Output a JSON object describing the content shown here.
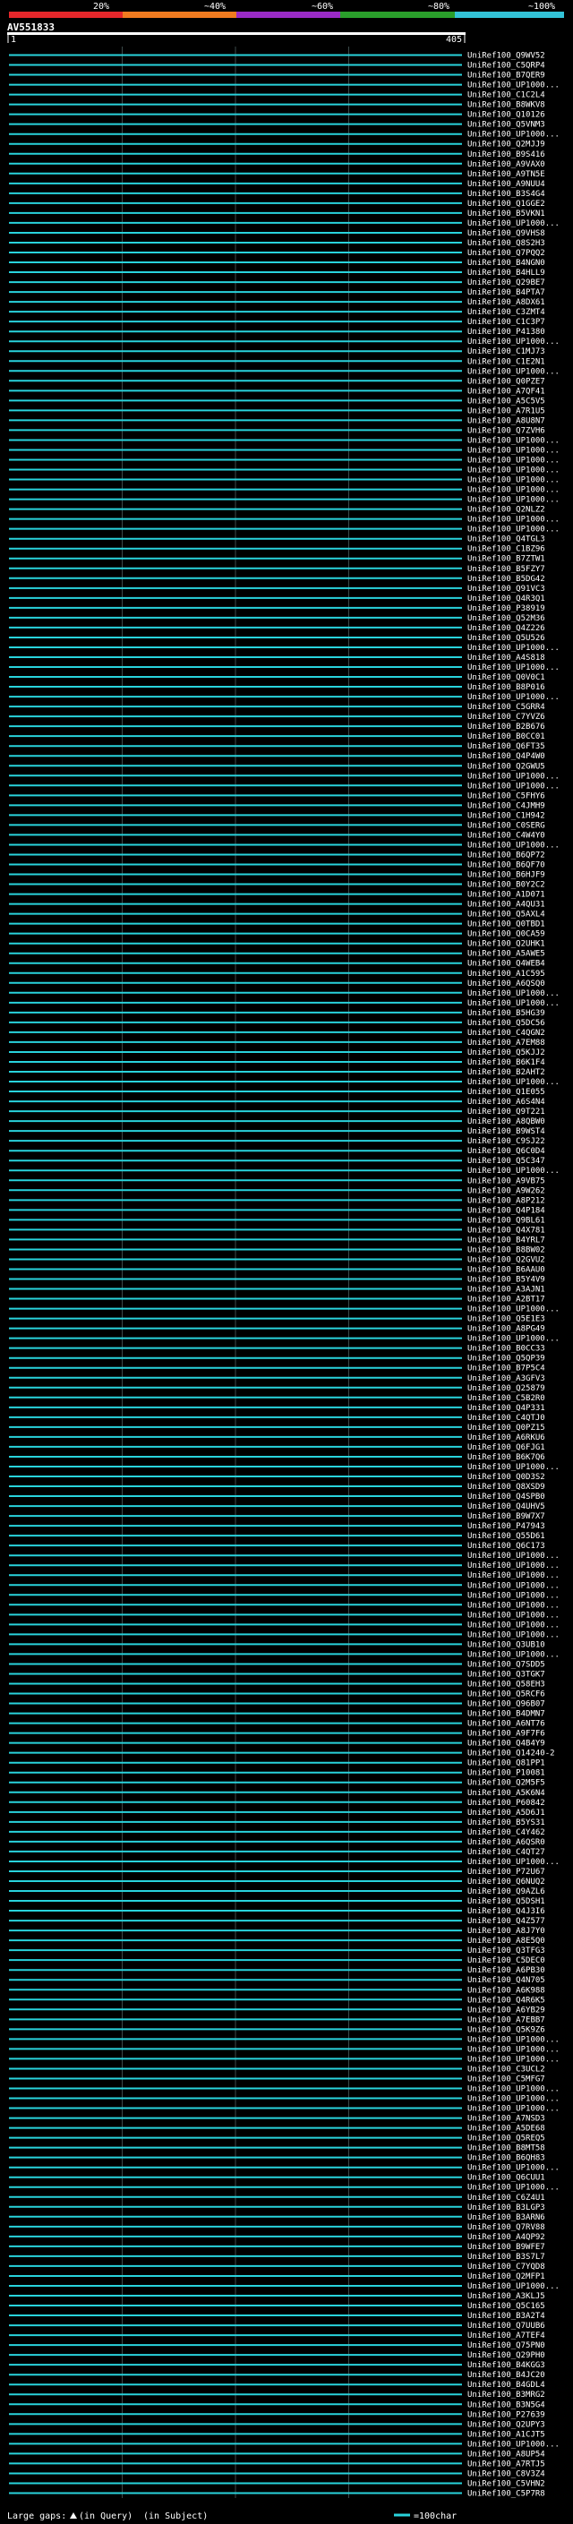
{
  "header": {
    "query_id": "AV551833",
    "percent_ticks": [
      "20%",
      "~40%",
      "~60%",
      "~80%",
      "~100%"
    ],
    "ruler_start": "1",
    "ruler_end": "405"
  },
  "legend": {
    "large_gaps_label": "Large gaps:",
    "query_gap_label": "(in Query)",
    "subject_gap_label": "(in Subject)",
    "scale_label": "=100char"
  },
  "colors": {
    "hit_line": "#29d3dc",
    "gridline": "#3b4a4a",
    "bar_red": "#e5272b",
    "bar_orange": "#f07b20",
    "bar_purple": "#9a2bc5",
    "bar_green": "#2a9f2b",
    "bar_cyan": "#33c3d8"
  },
  "chart_data": {
    "type": "alignment-overview",
    "query_length": 405,
    "x_range": [
      1,
      405
    ],
    "hits": [
      "UniRef100_Q9WV52",
      "UniRef100_C5QRP4",
      "UniRef100_B7QER9",
      "UniRef100_UP1000...",
      "UniRef100_C1C2L4",
      "UniRef100_B8WKV8",
      "UniRef100_Q10126",
      "UniRef100_Q5VNM3",
      "UniRef100_UP1000...",
      "UniRef100_Q2MJJ9",
      "UniRef100_B9S416",
      "UniRef100_A9VAX0",
      "UniRef100_A9TN5E",
      "UniRef100_A9NUU4",
      "UniRef100_B3S4G4",
      "UniRef100_Q1GGE2",
      "UniRef100_B5VKN1",
      "UniRef100_UP1000...",
      "UniRef100_Q9VHS8",
      "UniRef100_Q8S2H3",
      "UniRef100_Q7PQQ2",
      "UniRef100_B4NGN0",
      "UniRef100_B4HLL9",
      "UniRef100_Q29BE7",
      "UniRef100_B4PTA7",
      "UniRef100_A8DX61",
      "UniRef100_C3ZMT4",
      "UniRef100_C1C3P7",
      "UniRef100_P41380",
      "UniRef100_UP1000...",
      "UniRef100_C1MJ73",
      "UniRef100_C1E2N1",
      "UniRef100_UP1000...",
      "UniRef100_Q0PZE7",
      "UniRef100_A7QF41",
      "UniRef100_A5C5V5",
      "UniRef100_A7R1U5",
      "UniRef100_A8U8N7",
      "UniRef100_Q7ZVH6",
      "UniRef100_UP1000...",
      "UniRef100_UP1000...",
      "UniRef100_UP1000...",
      "UniRef100_UP1000...",
      "UniRef100_UP1000...",
      "UniRef100_UP1000...",
      "UniRef100_UP1000...",
      "UniRef100_Q2NLZ2",
      "UniRef100_UP1000...",
      "UniRef100_UP1000...",
      "UniRef100_Q4TGL3",
      "UniRef100_C1BZ96",
      "UniRef100_B7ZTW1",
      "UniRef100_B5FZY7",
      "UniRef100_B5DG42",
      "UniRef100_Q91VC3",
      "UniRef100_Q4R3Q1",
      "UniRef100_P38919",
      "UniRef100_Q52M36",
      "UniRef100_Q4Z226",
      "UniRef100_Q5U526",
      "UniRef100_UP1000...",
      "UniRef100_A4S818",
      "UniRef100_UP1000...",
      "UniRef100_Q0V0C1",
      "UniRef100_B8P016",
      "UniRef100_UP1000...",
      "UniRef100_C5GRR4",
      "UniRef100_C7YVZ6",
      "UniRef100_B2B676",
      "UniRef100_B0CC01",
      "UniRef100_Q6FT35",
      "UniRef100_Q4P4W0",
      "UniRef100_Q2GWU5",
      "UniRef100_UP1000...",
      "UniRef100_UP1000...",
      "UniRef100_C5FHY6",
      "UniRef100_C4JMH9",
      "UniRef100_C1H942",
      "UniRef100_C0SERG",
      "UniRef100_C4W4Y0",
      "UniRef100_UP1000...",
      "UniRef100_B6QP72",
      "UniRef100_B6QF70",
      "UniRef100_B6HJF9",
      "UniRef100_B0Y2C2",
      "UniRef100_A1D071",
      "UniRef100_A4QU31",
      "UniRef100_Q5AXL4",
      "UniRef100_Q0TBD1",
      "UniRef100_Q0CA59",
      "UniRef100_Q2UHK1",
      "UniRef100_A5AWE5",
      "UniRef100_Q4WEB4",
      "UniRef100_A1C595",
      "UniRef100_A6QSQ0",
      "UniRef100_UP1000...",
      "UniRef100_UP1000...",
      "UniRef100_B5HG39",
      "UniRef100_Q5DC56",
      "UniRef100_C4QGN2",
      "UniRef100_A7EM88",
      "UniRef100_Q5KJJ2",
      "UniRef100_B6K1F4",
      "UniRef100_B2AHT2",
      "UniRef100_UP1000...",
      "UniRef100_Q1E055",
      "UniRef100_A6S4N4",
      "UniRef100_Q9T221",
      "UniRef100_A8QBW0",
      "UniRef100_B9WST4",
      "UniRef100_C9SJ22",
      "UniRef100_Q6C0D4",
      "UniRef100_Q5C347",
      "UniRef100_UP1000...",
      "UniRef100_A9VB75",
      "UniRef100_A9W262",
      "UniRef100_A8P212",
      "UniRef100_Q4P184",
      "UniRef100_Q9BL61",
      "UniRef100_Q4X781",
      "UniRef100_B4YRL7",
      "UniRef100_B8BW02",
      "UniRef100_Q2GVU2",
      "UniRef100_B6AAU0",
      "UniRef100_B5Y4V9",
      "UniRef100_A3AJN1",
      "UniRef100_A2BT17",
      "UniRef100_UP1000...",
      "UniRef100_Q5E1E3",
      "UniRef100_A8PG49",
      "UniRef100_UP1000...",
      "UniRef100_B0CC33",
      "UniRef100_Q5QP39",
      "UniRef100_B7P5C4",
      "UniRef100_A3GFV3",
      "UniRef100_Q25879",
      "UniRef100_C5B2R0",
      "UniRef100_Q4P331",
      "UniRef100_C4QTJ0",
      "UniRef100_Q0PZ15",
      "UniRef100_A6RKU6",
      "UniRef100_Q6FJG1",
      "UniRef100_B6K7Q6",
      "UniRef100_UP1000...",
      "UniRef100_Q0D3S2",
      "UniRef100_Q8XSD9",
      "UniRef100_Q4SPB0",
      "UniRef100_Q4UHV5",
      "UniRef100_B9W7X7",
      "UniRef100_P47943",
      "UniRef100_Q55D61",
      "UniRef100_Q6C173",
      "UniRef100_UP1000...",
      "UniRef100_UP1000...",
      "UniRef100_UP1000...",
      "UniRef100_UP1000...",
      "UniRef100_UP1000...",
      "UniRef100_UP1000...",
      "UniRef100_UP1000...",
      "UniRef100_UP1000...",
      "UniRef100_UP1000...",
      "UniRef100_Q3UB10",
      "UniRef100_UP1000...",
      "UniRef100_Q7SDD5",
      "UniRef100_Q3TGK7",
      "UniRef100_Q58EH3",
      "UniRef100_Q5RCF6",
      "UniRef100_Q96B07",
      "UniRef100_B4DMN7",
      "UniRef100_A6NT76",
      "UniRef100_A9F7F6",
      "UniRef100_Q4B4Y9",
      "UniRef100_Q14240-2",
      "UniRef100_Q81PP1",
      "UniRef100_P10081",
      "UniRef100_Q2M5F5",
      "UniRef100_A5K6N4",
      "UniRef100_P60842",
      "UniRef100_A5D6J1",
      "UniRef100_B5YS31",
      "UniRef100_C4Y462",
      "UniRef100_A6QSR0",
      "UniRef100_C4QT27",
      "UniRef100_UP1000...",
      "UniRef100_P72U67",
      "UniRef100_Q6NUQ2",
      "UniRef100_Q9AZL6",
      "UniRef100_Q5DSH1",
      "UniRef100_Q4J3I6",
      "UniRef100_Q4Z577",
      "UniRef100_A8J7Y0",
      "UniRef100_A8E5Q0",
      "UniRef100_Q3TFG3",
      "UniRef100_C5DEC0",
      "UniRef100_A6PB30",
      "UniRef100_Q4N705",
      "UniRef100_A6K988",
      "UniRef100_Q4R6K5",
      "UniRef100_A6YB29",
      "UniRef100_A7EBB7",
      "UniRef100_Q5K9Z6",
      "UniRef100_UP1000...",
      "UniRef100_UP1000...",
      "UniRef100_UP1000...",
      "UniRef100_C3UCL2",
      "UniRef100_C5MFG7",
      "UniRef100_UP1000...",
      "UniRef100_UP1000...",
      "UniRef100_UP1000...",
      "UniRef100_A7NSD3",
      "UniRef100_A5DE68",
      "UniRef100_Q5REQ5",
      "UniRef100_B8MT58",
      "UniRef100_B6QH83",
      "UniRef100_UP1000...",
      "UniRef100_Q6CUU1",
      "UniRef100_UP1000...",
      "UniRef100_C6Z4U1",
      "UniRef100_B3LGP3",
      "UniRef100_B3ARN6",
      "UniRef100_Q7RV88",
      "UniRef100_A4QP92",
      "UniRef100_B9WFE7",
      "UniRef100_B3S7L7",
      "UniRef100_C7YQD8",
      "UniRef100_Q2MFP1",
      "UniRef100_UP1000...",
      "UniRef100_A3KLJ5",
      "UniRef100_Q5C165",
      "UniRef100_B3A2T4",
      "UniRef100_Q7UUB6",
      "UniRef100_A7TEF4",
      "UniRef100_Q75PN0",
      "UniRef100_Q29PH0",
      "UniRef100_B4KGG3",
      "UniRef100_B4JC20",
      "UniRef100_B4GDL4",
      "UniRef100_B3MRG2",
      "UniRef100_B3N5G4",
      "UniRef100_P27639",
      "UniRef100_Q2UPY3",
      "UniRef100_A1CJT5",
      "UniRef100_UP1000...",
      "UniRef100_A8UP54",
      "UniRef100_A7RTJ5",
      "UniRef100_C8V3Z4",
      "UniRef100_C5VHN2",
      "UniRef100_C5P7R8"
    ]
  }
}
